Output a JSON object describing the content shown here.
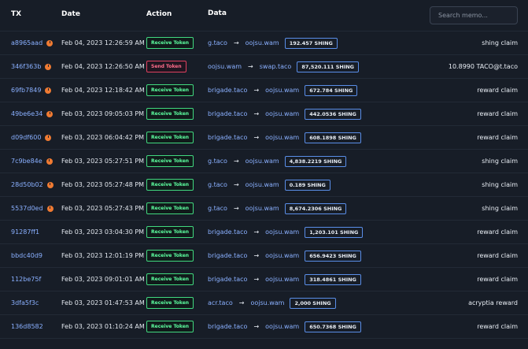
{
  "header": {
    "tx": "TX",
    "date": "Date",
    "action": "Action",
    "data": "Data",
    "search_placeholder": "Search memo..."
  },
  "rows": [
    {
      "tx": "a8965aad",
      "pending": true,
      "date": "Feb 04, 2023 12:26:59 AM",
      "action": "Receive Token",
      "type": "recv",
      "from": "g.taco",
      "to": "oojsu.wam",
      "amount": "192.457 SHING",
      "memo": "shing claim"
    },
    {
      "tx": "346f363b",
      "pending": true,
      "date": "Feb 04, 2023 12:26:50 AM",
      "action": "Send Token",
      "type": "send",
      "from": "oojsu.wam",
      "to": "swap.taco",
      "amount": "87,520.111 SHING",
      "memo": "10.8990 TACO@t.taco"
    },
    {
      "tx": "69fb7849",
      "pending": true,
      "date": "Feb 04, 2023 12:18:42 AM",
      "action": "Receive Token",
      "type": "recv",
      "from": "brigade.taco",
      "to": "oojsu.wam",
      "amount": "672.784 SHING",
      "memo": "reward claim"
    },
    {
      "tx": "49be6e34",
      "pending": true,
      "date": "Feb 03, 2023 09:05:03 PM",
      "action": "Receive Token",
      "type": "recv",
      "from": "brigade.taco",
      "to": "oojsu.wam",
      "amount": "442.0536 SHING",
      "memo": "reward claim"
    },
    {
      "tx": "d09df600",
      "pending": true,
      "date": "Feb 03, 2023 06:04:42 PM",
      "action": "Receive Token",
      "type": "recv",
      "from": "brigade.taco",
      "to": "oojsu.wam",
      "amount": "608.1898 SHING",
      "memo": "reward claim"
    },
    {
      "tx": "7c9be84e",
      "pending": true,
      "date": "Feb 03, 2023 05:27:51 PM",
      "action": "Receive Token",
      "type": "recv",
      "from": "g.taco",
      "to": "oojsu.wam",
      "amount": "4,838.2219 SHING",
      "memo": "shing claim"
    },
    {
      "tx": "28d50b02",
      "pending": true,
      "date": "Feb 03, 2023 05:27:48 PM",
      "action": "Receive Token",
      "type": "recv",
      "from": "g.taco",
      "to": "oojsu.wam",
      "amount": "0.189 SHING",
      "memo": "shing claim"
    },
    {
      "tx": "5537d0ed",
      "pending": true,
      "date": "Feb 03, 2023 05:27:43 PM",
      "action": "Receive Token",
      "type": "recv",
      "from": "g.taco",
      "to": "oojsu.wam",
      "amount": "8,674.2306 SHING",
      "memo": "shing claim"
    },
    {
      "tx": "91287ff1",
      "pending": false,
      "date": "Feb 03, 2023 03:04:30 PM",
      "action": "Receive Token",
      "type": "recv",
      "from": "brigade.taco",
      "to": "oojsu.wam",
      "amount": "1,203.101 SHING",
      "memo": "reward claim"
    },
    {
      "tx": "bbdc40d9",
      "pending": false,
      "date": "Feb 03, 2023 12:01:19 PM",
      "action": "Receive Token",
      "type": "recv",
      "from": "brigade.taco",
      "to": "oojsu.wam",
      "amount": "656.9423 SHING",
      "memo": "reward claim"
    },
    {
      "tx": "112be75f",
      "pending": false,
      "date": "Feb 03, 2023 09:01:01 AM",
      "action": "Receive Token",
      "type": "recv",
      "from": "brigade.taco",
      "to": "oojsu.wam",
      "amount": "318.4861 SHING",
      "memo": "reward claim"
    },
    {
      "tx": "3dfa5f3c",
      "pending": false,
      "date": "Feb 03, 2023 01:47:53 AM",
      "action": "Receive Token",
      "type": "recv",
      "from": "acr.taco",
      "to": "oojsu.wam",
      "amount": "2,000 SHING",
      "memo": "acryptia reward"
    },
    {
      "tx": "136d8582",
      "pending": false,
      "date": "Feb 03, 2023 01:10:24 AM",
      "action": "Receive Token",
      "type": "recv",
      "from": "brigade.taco",
      "to": "oojsu.wam",
      "amount": "650.7368 SHING",
      "memo": "reward claim"
    }
  ],
  "arrow": "→",
  "colors": {
    "background": "#171d27",
    "link": "#8ab0ff",
    "receive": "#41d97f",
    "send": "#e0405f",
    "pending": "#ef7a32"
  }
}
